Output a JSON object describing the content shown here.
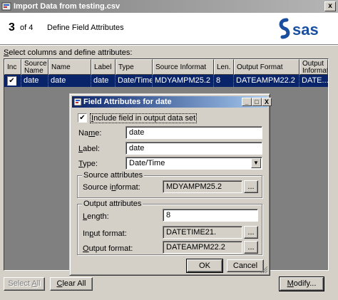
{
  "window": {
    "title": "Import Data from testing.csv",
    "close": "x"
  },
  "header": {
    "step_number": "3",
    "step_of": "of 4",
    "step_title": "Define Field Attributes",
    "logo_text": "sas"
  },
  "instructions": {
    "pre": "",
    "accel": "S",
    "post": "elect columns and define attributes:"
  },
  "table": {
    "headers": {
      "inc": "Inc",
      "source_name_1": "Source",
      "source_name_2": "Name",
      "name": "Name",
      "label": "Label",
      "type": "Type",
      "source_informat": "Source Informat",
      "len": "Len.",
      "output_format": "Output Format",
      "output_informat_1": "Output",
      "output_informat_2": "Informat"
    },
    "rows": [
      {
        "included": "✔",
        "source_name": "date",
        "name": "date",
        "label": "date",
        "type": "Date/Time",
        "source_informat": "MDYAMPM25.2",
        "len": "8",
        "output_format": "DATEAMPM22.2",
        "output_informat": "DATE..."
      }
    ]
  },
  "buttons": {
    "select_all": {
      "accel": "",
      "rest_pre": "Select ",
      "accel2": "A",
      "rest": "ll"
    },
    "clear_all": {
      "accel": "C",
      "rest": "lear All"
    },
    "modify": {
      "accel": "M",
      "rest": "odify..."
    }
  },
  "dialog": {
    "title": "Field Attributes for date",
    "minimize": "_",
    "maximize": "□",
    "close": "X",
    "include_check": "✔",
    "include_label": {
      "accel": "I",
      "rest": "nclude field in output data set"
    },
    "name_label": {
      "pre": "Na",
      "accel": "m",
      "post": "e:"
    },
    "name_value": "date",
    "label_label": {
      "accel": "L",
      "post": "abel:"
    },
    "label_value": "date",
    "type_label": {
      "accel": "T",
      "post": "ype:"
    },
    "type_value": "Date/Time",
    "source_group": "Source attributes",
    "source_informat_label": {
      "pre": "Source i",
      "accel": "n",
      "post": "format:"
    },
    "source_informat_value": "MDYAMPM25.2",
    "output_group": "Output attributes",
    "length_label": {
      "accel": "L",
      "post": "ength:"
    },
    "length_value": "8",
    "input_format_label": {
      "pre": "In",
      "accel": "p",
      "post": "ut format:"
    },
    "input_format_value": "DATETIME21.",
    "output_format_label": {
      "accel": "O",
      "post": "utput format:"
    },
    "output_format_value": "DATEAMPM22.2",
    "ellipsis": "...",
    "ok": "OK",
    "cancel": "Cancel"
  },
  "colors": {
    "selection": "#0a246a",
    "face": "#d4d0c8",
    "logo_blue": "#1a4fa0"
  }
}
